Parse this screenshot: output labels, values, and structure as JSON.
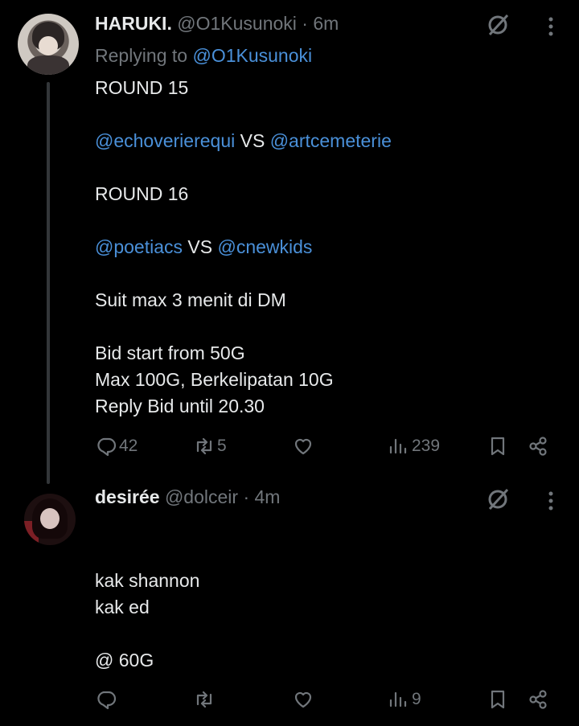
{
  "tweets": [
    {
      "name": "HARUKI.",
      "handle": "@O1Kusunoki",
      "separator": "·",
      "time": "6m",
      "replying_label": "Replying to",
      "replying_handle": "@O1Kusunoki",
      "lines": [
        {
          "text": "ROUND 15"
        },
        {
          "text": ""
        },
        {
          "parts": [
            {
              "t": "@echoverierequi",
              "m": true
            },
            {
              "t": " VS ",
              "m": false
            },
            {
              "t": "@artcemeterie",
              "m": true
            }
          ]
        },
        {
          "text": ""
        },
        {
          "text": "ROUND 16"
        },
        {
          "text": ""
        },
        {
          "parts": [
            {
              "t": "@poetiacs",
              "m": true
            },
            {
              "t": " VS ",
              "m": false
            },
            {
              "t": "@cnewkids",
              "m": true
            }
          ]
        },
        {
          "text": ""
        },
        {
          "text": "Suit max 3 menit di DM"
        },
        {
          "text": ""
        },
        {
          "text": "Bid start from 50G"
        },
        {
          "text": "Max 100G, Berkelipatan 10G"
        },
        {
          "text": "Reply Bid until 20.30"
        }
      ],
      "actions": {
        "replies": "42",
        "retweets": "5",
        "likes": "",
        "views": "239"
      }
    },
    {
      "name": "desirée",
      "handle": "@dolceir",
      "separator": "·",
      "time": "4m",
      "lines": [
        {
          "text": ""
        },
        {
          "text": "kak shannon"
        },
        {
          "text": "kak ed"
        },
        {
          "text": ""
        },
        {
          "text": "@ 60G"
        }
      ],
      "actions": {
        "replies": "",
        "retweets": "",
        "likes": "",
        "views": "9"
      }
    }
  ],
  "colors": {
    "background": "#000000",
    "text": "#e7e9ea",
    "muted": "#71767b",
    "mention": "#4a90d9"
  },
  "icons": [
    "grok-icon",
    "more-icon",
    "reply-icon",
    "retweet-icon",
    "like-icon",
    "views-icon",
    "bookmark-icon",
    "share-icon"
  ]
}
